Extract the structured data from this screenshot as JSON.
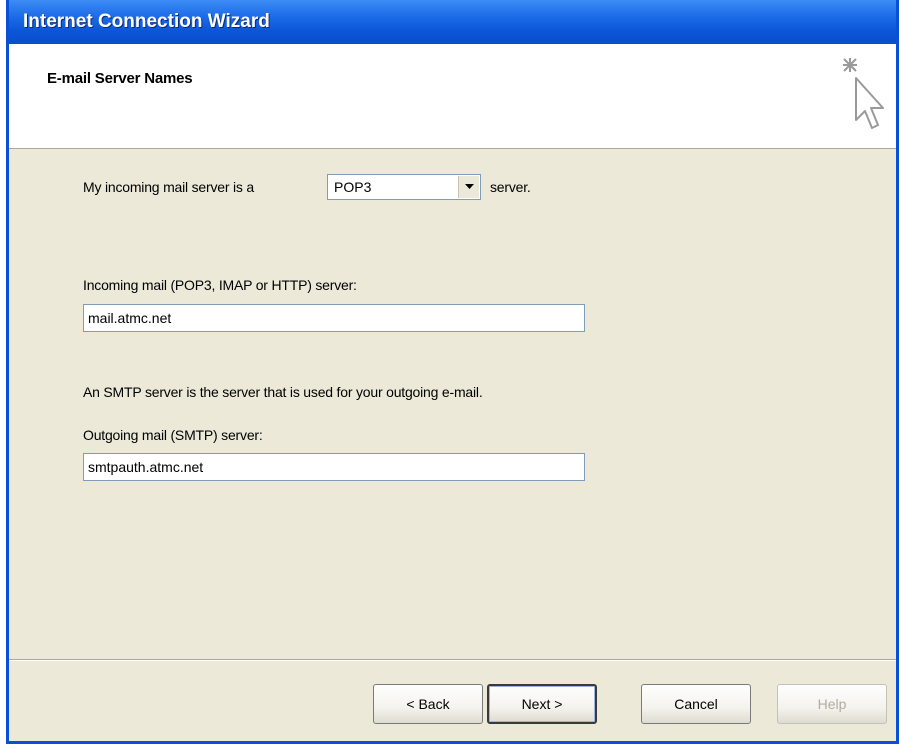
{
  "window": {
    "title": "Internet Connection Wizard"
  },
  "header": {
    "heading": "E-mail Server Names"
  },
  "incoming_type": {
    "prefix": "My incoming mail server is a",
    "selected": "POP3",
    "suffix": "server."
  },
  "incoming": {
    "label": "Incoming mail (POP3, IMAP or HTTP) server:",
    "value": "mail.atmc.net"
  },
  "smtp_note": "An SMTP server is the server that is used for your outgoing e-mail.",
  "outgoing": {
    "label": "Outgoing mail (SMTP) server:",
    "value": "smtpauth.atmc.net"
  },
  "buttons": {
    "back": "< Back",
    "next": "Next >",
    "cancel": "Cancel",
    "help": "Help"
  },
  "icons": {
    "wizard": "wizard-cursor-sparkle-icon",
    "dropdown": "chevron-down-icon"
  }
}
